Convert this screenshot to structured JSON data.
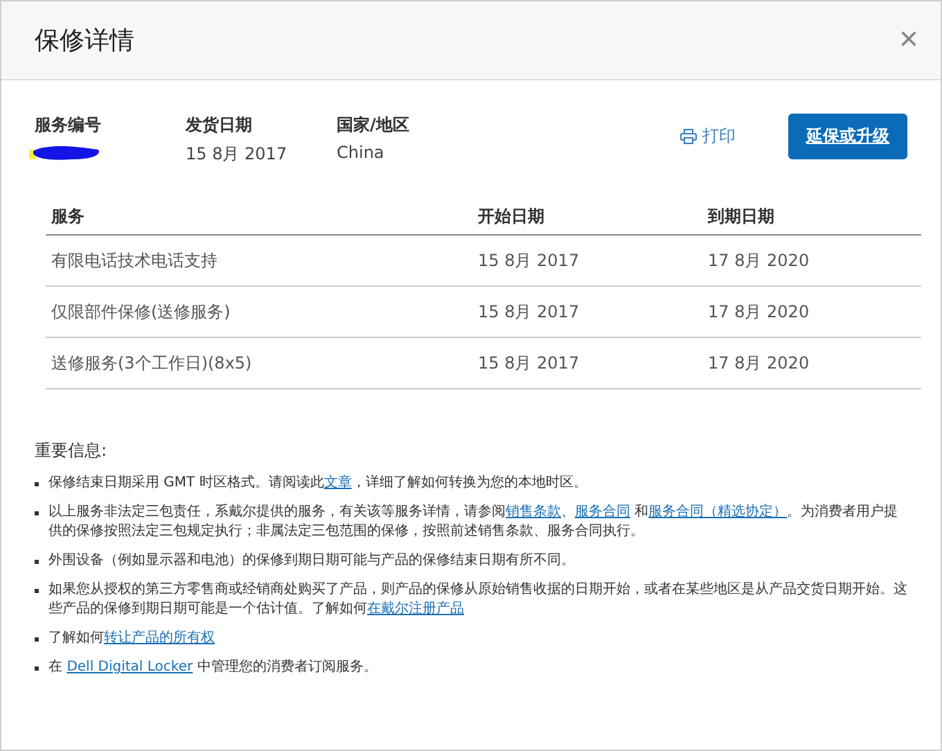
{
  "window": {
    "title": "保修详情",
    "close": "×"
  },
  "summary": [
    {
      "label": "服务编号",
      "kind": "redacted"
    },
    {
      "label": "发货日期",
      "kind": "text",
      "value": "15 8月 2017"
    },
    {
      "label": "国家/地区",
      "kind": "text",
      "value": "China"
    }
  ],
  "print_link": "打印",
  "upgrade_button": "延保或升级",
  "table": {
    "columns": [
      "服务",
      "开始日期",
      "到期日期"
    ],
    "rows": [
      [
        "有限电话技术电话支持",
        "15 8月 2017",
        "17 8月 2020"
      ],
      [
        "仅限部件保修(送修服务)",
        "15 8月 2017",
        "17 8月 2020"
      ],
      [
        "送修服务(3个工作日)(8x5)",
        "15 8月 2017",
        "17 8月 2020"
      ]
    ]
  },
  "notes_title": "重要信息:",
  "notes": [
    [
      {
        "text": "保修结束日期采用 GMT 时区格式。请阅读此"
      },
      {
        "text": "文章",
        "link": true
      },
      {
        "text": "，详细了解如何转换为您的本地时区。"
      }
    ],
    [
      {
        "text": "以上服务非法定三包责任，系戴尔提供的服务，有关该等服务详情，请参阅"
      },
      {
        "text": "销售条款",
        "link": true
      },
      {
        "text": "、"
      },
      {
        "text": "服务合同",
        "link": true
      },
      {
        "text": " 和"
      },
      {
        "text": "服务合同（精选协定）",
        "link": true
      },
      {
        "text": "。为消费者用户提供的保修按照法定三包规定执行；非属法定三包范围的保修，按照前述销售条款、服务合同执行。"
      }
    ],
    [
      {
        "text": "外围设备（例如显示器和电池）的保修到期日期可能与产品的保修结束日期有所不同。"
      }
    ],
    [
      {
        "text": "如果您从授权的第三方零售商或经销商处购买了产品，则产品的保修从原始销售收据的日期开始，或者在某些地区是从产品交货日期开始。这些产品的保修到期日期可能是一个估计值。了解如何"
      },
      {
        "text": "在戴尔注册产品",
        "link": true
      }
    ],
    [
      {
        "text": "了解如何"
      },
      {
        "text": "转让产品的所有权",
        "link": true
      }
    ],
    [
      {
        "text": "在 "
      },
      {
        "text": "Dell Digital Locker",
        "link": true
      },
      {
        "text": " 中管理您的消费者订阅服务。"
      }
    ]
  ]
}
